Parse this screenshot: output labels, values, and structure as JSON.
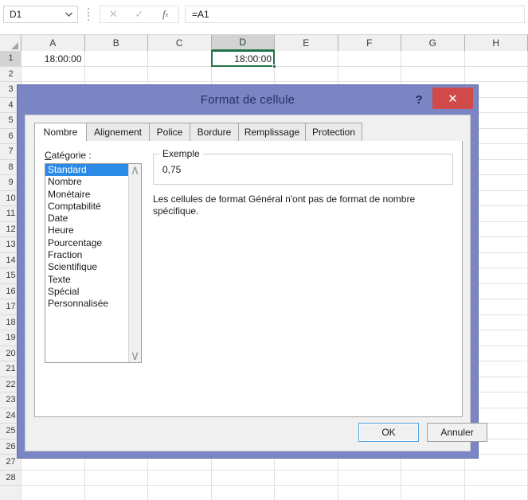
{
  "formula_bar": {
    "name_box_value": "D1",
    "name_box_arrow_icon": "chevron-down-icon",
    "cancel_icon": "cross-icon",
    "cancel_glyph": "✕",
    "confirm_icon": "checkmark-icon",
    "confirm_glyph": "✓",
    "function_icon": "fx-icon",
    "function_glyph": "fx",
    "formula_value": "=A1"
  },
  "grid": {
    "columns": [
      "A",
      "B",
      "C",
      "D",
      "E",
      "F",
      "G",
      "H"
    ],
    "selected_column": "D",
    "rows": [
      1,
      2,
      3,
      4,
      5,
      6,
      7,
      8,
      9,
      10,
      11,
      12,
      13,
      14,
      15,
      16,
      17,
      18,
      19,
      20,
      21,
      22,
      23,
      24,
      25,
      26,
      27,
      28
    ],
    "selected_row": 1,
    "cells": {
      "A1": "18:00:00",
      "D1": "18:00:00"
    },
    "active_cell": "D1",
    "selection_color": "#217346"
  },
  "dialog": {
    "title": "Format de cellule",
    "titlebar_color": "#7b85c4",
    "help_button_label": "?",
    "close_button_label": "✕",
    "close_button_color": "#d04a4a",
    "tabs": [
      {
        "label": "Nombre",
        "active": true
      },
      {
        "label": "Alignement",
        "active": false
      },
      {
        "label": "Police",
        "active": false
      },
      {
        "label": "Bordure",
        "active": false
      },
      {
        "label": "Remplissage",
        "active": false
      },
      {
        "label": "Protection",
        "active": false
      }
    ],
    "category_label": "Catégorie :",
    "categories": [
      "Standard",
      "Nombre",
      "Monétaire",
      "Comptabilité",
      "Date",
      "Heure",
      "Pourcentage",
      "Fraction",
      "Scientifique",
      "Texte",
      "Spécial",
      "Personnalisée"
    ],
    "selected_category": "Standard",
    "selected_category_color": "#2b8ae5",
    "scrollbar": {
      "up_arrow_icon": "chevron-up-icon",
      "up_arrow_glyph": "∧",
      "down_arrow_icon": "chevron-down-icon",
      "down_arrow_glyph": "∨"
    },
    "example_legend": "Exemple",
    "example_value": "0,75",
    "description": "Les cellules de format Général n'ont pas de format de nombre spécifique.",
    "ok_label": "OK",
    "cancel_label": "Annuler"
  }
}
